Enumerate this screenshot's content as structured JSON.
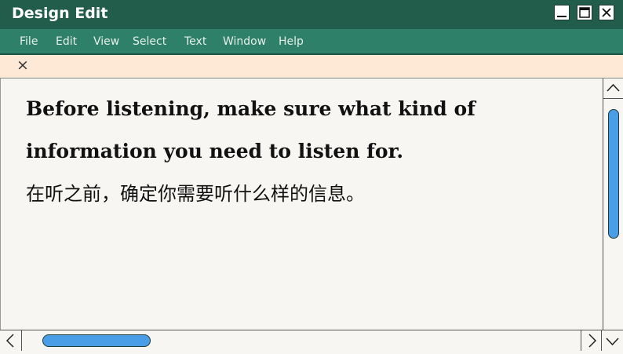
{
  "window": {
    "title": "Design Edit",
    "controls": [
      "minimize",
      "maximize",
      "close"
    ]
  },
  "menu": {
    "items": [
      "File",
      "Edit",
      "View",
      "Select",
      "Text",
      "Window",
      "Help"
    ]
  },
  "tab": {
    "close_glyph": "×"
  },
  "document": {
    "english_text": "Before listening, make sure what kind of information you need to listen for.",
    "chinese_text": "在听之前，确定你需要听什么样的信息。"
  },
  "scrollbars": {
    "vertical_position": 0.0,
    "horizontal_position": 0.0
  },
  "colors": {
    "titlebar": "#225c4a",
    "menubar": "#2e8069",
    "tabbar": "#fde9d6",
    "scroll_thumb": "#4a9ee8"
  }
}
